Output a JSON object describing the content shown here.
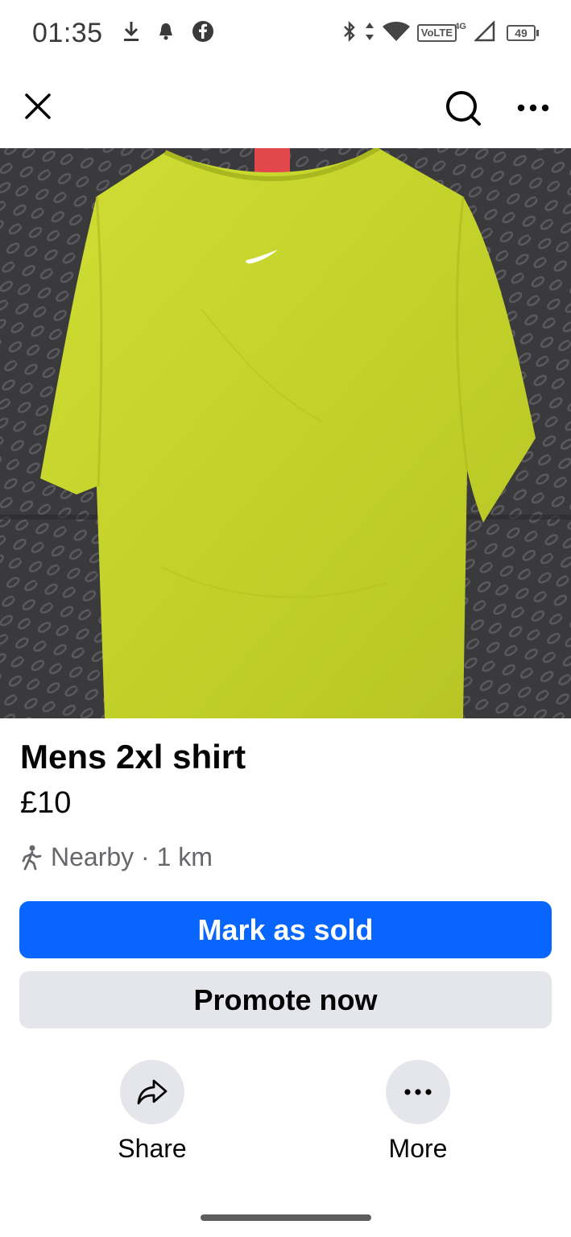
{
  "status_bar": {
    "time": "01:35",
    "left_icons": [
      "download-icon",
      "notification-icon",
      "facebook-icon"
    ],
    "right_icons": [
      "bluetooth-icon",
      "data-arrows-icon",
      "wifi-icon",
      "volte-icon",
      "signal-icon",
      "battery-icon"
    ],
    "volte": "VoLTE",
    "network": "4G",
    "battery": "49"
  },
  "nav": {
    "icons": [
      "close-icon",
      "search-icon",
      "more-horizontal-icon"
    ]
  },
  "listing": {
    "image_subject": "lime green t-shirt",
    "title": "Mens 2xl shirt",
    "price": "£10",
    "location": "Nearby · 1 km",
    "location_icon": "walking-person-icon"
  },
  "buttons": {
    "primary_label": "Mark as sold",
    "secondary_label": "Promote now"
  },
  "actions": [
    {
      "label": "Share",
      "icon": "share-icon"
    },
    {
      "label": "More",
      "icon": "more-horizontal-icon"
    }
  ],
  "colors": {
    "primary": "#0866ff",
    "secondary_bg": "#e4e6eb",
    "secondary_text": "#65676b",
    "shirt": "#c6d62c"
  }
}
